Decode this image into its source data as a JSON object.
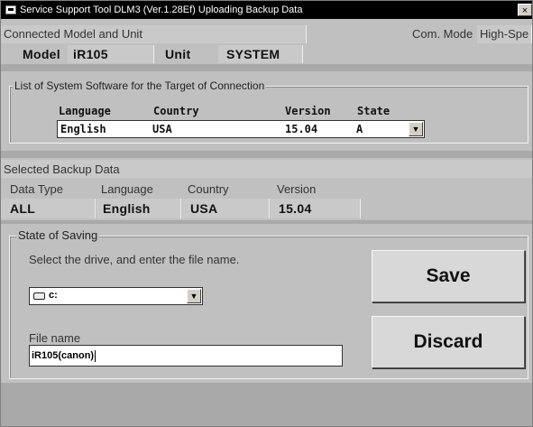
{
  "window": {
    "title": "Service Support Tool DLM3 (Ver.1.28Ef) Uploading Backup Data",
    "close_label": "×"
  },
  "connected": {
    "heading": "Connected Model and Unit",
    "com_mode_label": "Com. Mode",
    "com_mode_value": "High-Spe",
    "model_label": "Model",
    "model_value": "iR105",
    "unit_label": "Unit",
    "unit_value": "SYSTEM"
  },
  "system_software": {
    "group_title": "List of System Software for the Target of Connection",
    "columns": [
      "Language",
      "Country",
      "Version",
      "State"
    ],
    "selected_row": {
      "language": "English",
      "country": "USA",
      "version": "15.04",
      "state": "A"
    }
  },
  "backup": {
    "heading": "Selected Backup Data",
    "columns": [
      "Data Type",
      "Language",
      "Country",
      "Version"
    ],
    "values": [
      "ALL",
      "English",
      "USA",
      "15.04"
    ]
  },
  "saving": {
    "group_title": "State of Saving",
    "instruction": "Select the drive, and enter the file name.",
    "drive_value": "c:",
    "file_name_label": "File name",
    "file_name_value": "iR105(canon)",
    "save_label": "Save",
    "discard_label": "Discard"
  },
  "icons": {
    "app": "app-icon",
    "drive": "drive-icon",
    "dropdown_arrow": "chevron-down-icon"
  },
  "colors": {
    "panel": "#c0c0c0",
    "band": "#a9a9a9",
    "titlebar": "#000000"
  }
}
